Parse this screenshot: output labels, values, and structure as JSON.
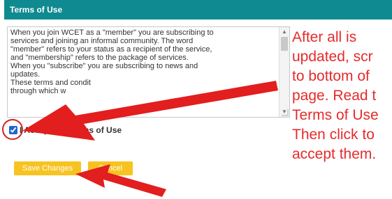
{
  "header": {
    "title": "Terms of Use"
  },
  "terms_box": {
    "lines": [
      "When you join WCET as a \"member\" you are subscribing to",
      "services and joining an informal community. The word",
      "\"member\" refers to your status as a recipient of the service,",
      "and \"membership\" refers to the package of services.",
      "When you \"subscribe\" you are subscribing to news and",
      "updates.",
      "These terms and condit",
      "through which w"
    ]
  },
  "accept": {
    "label": "I Accept the Terms of Use",
    "checked": true
  },
  "buttons": {
    "save": "Save Changes",
    "cancel": "Cancel"
  },
  "annotation": {
    "lines": [
      "After all is",
      "updated, scr",
      "to bottom of",
      "page. Read t",
      "Terms of Use",
      "Then click to",
      "accept them."
    ],
    "color": "#e52b2b"
  }
}
